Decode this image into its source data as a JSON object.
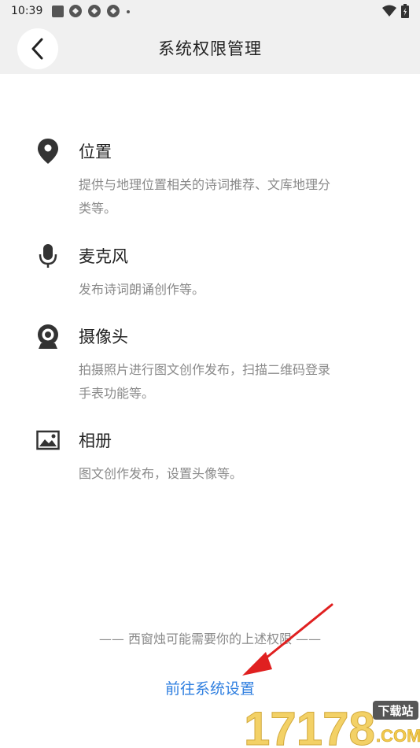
{
  "status_bar": {
    "time": "10:39",
    "left_icons": [
      "square-notification-icon",
      "app-icon",
      "app-icon",
      "app-icon",
      "dot-icon"
    ],
    "right_icons": [
      "wifi-icon",
      "battery-icon"
    ]
  },
  "header": {
    "title": "系统权限管理",
    "back_icon": "chevron-left-icon"
  },
  "permissions": [
    {
      "icon": "location-pin-icon",
      "title": "位置",
      "desc_line1": "提供与地理位置相关的诗词推荐、文库地理分",
      "desc_line2": "类等。"
    },
    {
      "icon": "microphone-icon",
      "title": "麦克风",
      "desc_line1": "发布诗词朗诵创作等。",
      "desc_line2": ""
    },
    {
      "icon": "camera-icon",
      "title": "摄像头",
      "desc_line1": "拍摄照片进行图文创作发布，扫描二维码登录",
      "desc_line2": "手表功能等。"
    },
    {
      "icon": "image-album-icon",
      "title": "相册",
      "desc_line1": "图文创作发布，设置头像等。",
      "desc_line2": ""
    }
  ],
  "notice": "—— 西窗烛可能需要你的上述权限 ——",
  "goto_settings_label": "前往系统设置",
  "watermark": {
    "logo_text": "17178",
    "badge": "下载站",
    "domain": ".COM"
  },
  "colors": {
    "header_bg": "#f0f0f0",
    "link_blue": "#2f7fe0",
    "muted_text": "#8a8a8a",
    "annotation_red": "#e02020"
  }
}
